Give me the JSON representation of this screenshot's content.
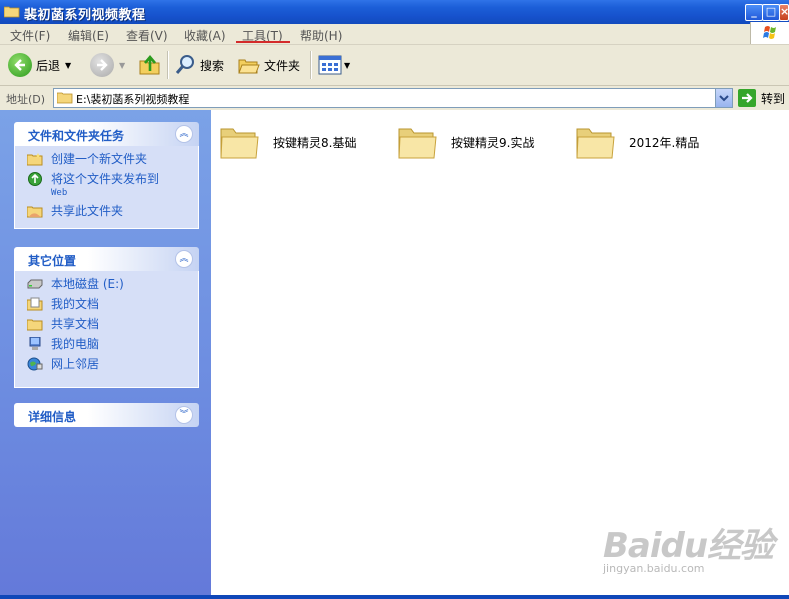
{
  "window": {
    "title": "裴初菡系列视频教程"
  },
  "menu": {
    "items": [
      {
        "label": "文件(F)"
      },
      {
        "label": "编辑(E)"
      },
      {
        "label": "查看(V)"
      },
      {
        "label": "收藏(A)"
      },
      {
        "label": "工具(T)"
      },
      {
        "label": "帮助(H)"
      }
    ]
  },
  "toolbar": {
    "back_label": "后退",
    "search_label": "搜索",
    "folders_label": "文件夹"
  },
  "address": {
    "label": "地址(D)",
    "value": "E:\\裴初菡系列视频教程",
    "go_label": "转到"
  },
  "tasks_panel": {
    "title": "文件和文件夹任务",
    "items": [
      {
        "label": "创建一个新文件夹",
        "icon": "new-folder-icon"
      },
      {
        "label": "将这个文件夹发布到",
        "sub": "Web",
        "icon": "publish-web-icon"
      },
      {
        "label": "共享此文件夹",
        "icon": "share-folder-icon"
      }
    ]
  },
  "places_panel": {
    "title": "其它位置",
    "items": [
      {
        "label": "本地磁盘 (E:)",
        "icon": "local-disk-icon"
      },
      {
        "label": "我的文档",
        "icon": "my-documents-icon"
      },
      {
        "label": "共享文档",
        "icon": "shared-documents-icon"
      },
      {
        "label": "我的电脑",
        "icon": "my-computer-icon"
      },
      {
        "label": "网上邻居",
        "icon": "network-places-icon"
      }
    ]
  },
  "details_panel": {
    "title": "详细信息"
  },
  "folders": [
    {
      "name": "按键精灵8.基础"
    },
    {
      "name": "按键精灵9.实战"
    },
    {
      "name": "2012年.精品"
    }
  ],
  "watermark": {
    "logo": "Baidu经验",
    "url": "jingyan.baidu.com"
  },
  "colors": {
    "titlebar": "#1c5fd8",
    "left_pane": "#6c8be0",
    "panel_link": "#215dc6",
    "menu_underline": "#d42b2b"
  }
}
